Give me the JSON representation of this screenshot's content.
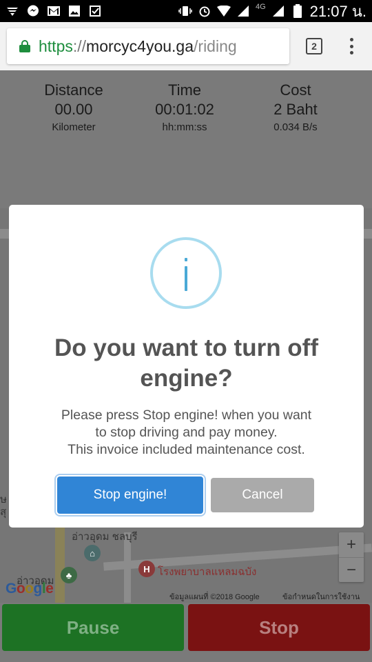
{
  "status_bar": {
    "icons": [
      "wifi-hotspot-icon",
      "messenger-icon",
      "gmail-icon",
      "gallery-icon",
      "check-app-icon"
    ],
    "right_icons": [
      "vibrate-icon",
      "alarm-icon",
      "wifi-icon",
      "signal-icon",
      "battery-icon"
    ],
    "network": "4G",
    "time": "21:07 น."
  },
  "browser": {
    "url_scheme": "https",
    "url_sep": "://",
    "url_host": "morcyc4you.ga",
    "url_path": "/riding",
    "tab_count": "2",
    "colors": {
      "secure": "#1e8e3e"
    }
  },
  "ride": {
    "distance": {
      "title": "Distance",
      "value": "00.00",
      "unit": "Kilometer"
    },
    "time": {
      "title": "Time",
      "value": "00:01:02",
      "unit": "hh:mm:ss"
    },
    "cost": {
      "title": "Cost",
      "value": "2 Baht",
      "unit": "0.034 B/s"
    }
  },
  "map": {
    "labels": {
      "area_top": "อ่าวอุดม ชลบุรี",
      "area_bottom": "อ่าวอุดม",
      "hospital": "โรงพยาบาลแหลมฉบัง",
      "side_1": "ษ",
      "side_2": "สุ"
    },
    "zoom_in": "+",
    "zoom_out": "−",
    "logo": "Google",
    "attribution": "ข้อมูลแผนที่ ©2018 Google",
    "terms": "ข้อกำหนดในการใช้งาน"
  },
  "dialog": {
    "title": "Do you want to turn off engine?",
    "text_lines": [
      "Please press Stop engine! when you want",
      "to stop driving and pay money.",
      "This invoice included maintenance cost."
    ],
    "confirm_label": "Stop engine!",
    "cancel_label": "Cancel",
    "colors": {
      "confirm": "#3085d6",
      "cancel": "#aaaaaa",
      "info": "#a8dcef"
    }
  },
  "controls": {
    "pause_label": "Pause",
    "stop_label": "Stop",
    "colors": {
      "pause": "#1d7224",
      "stop": "#7a1212"
    }
  }
}
